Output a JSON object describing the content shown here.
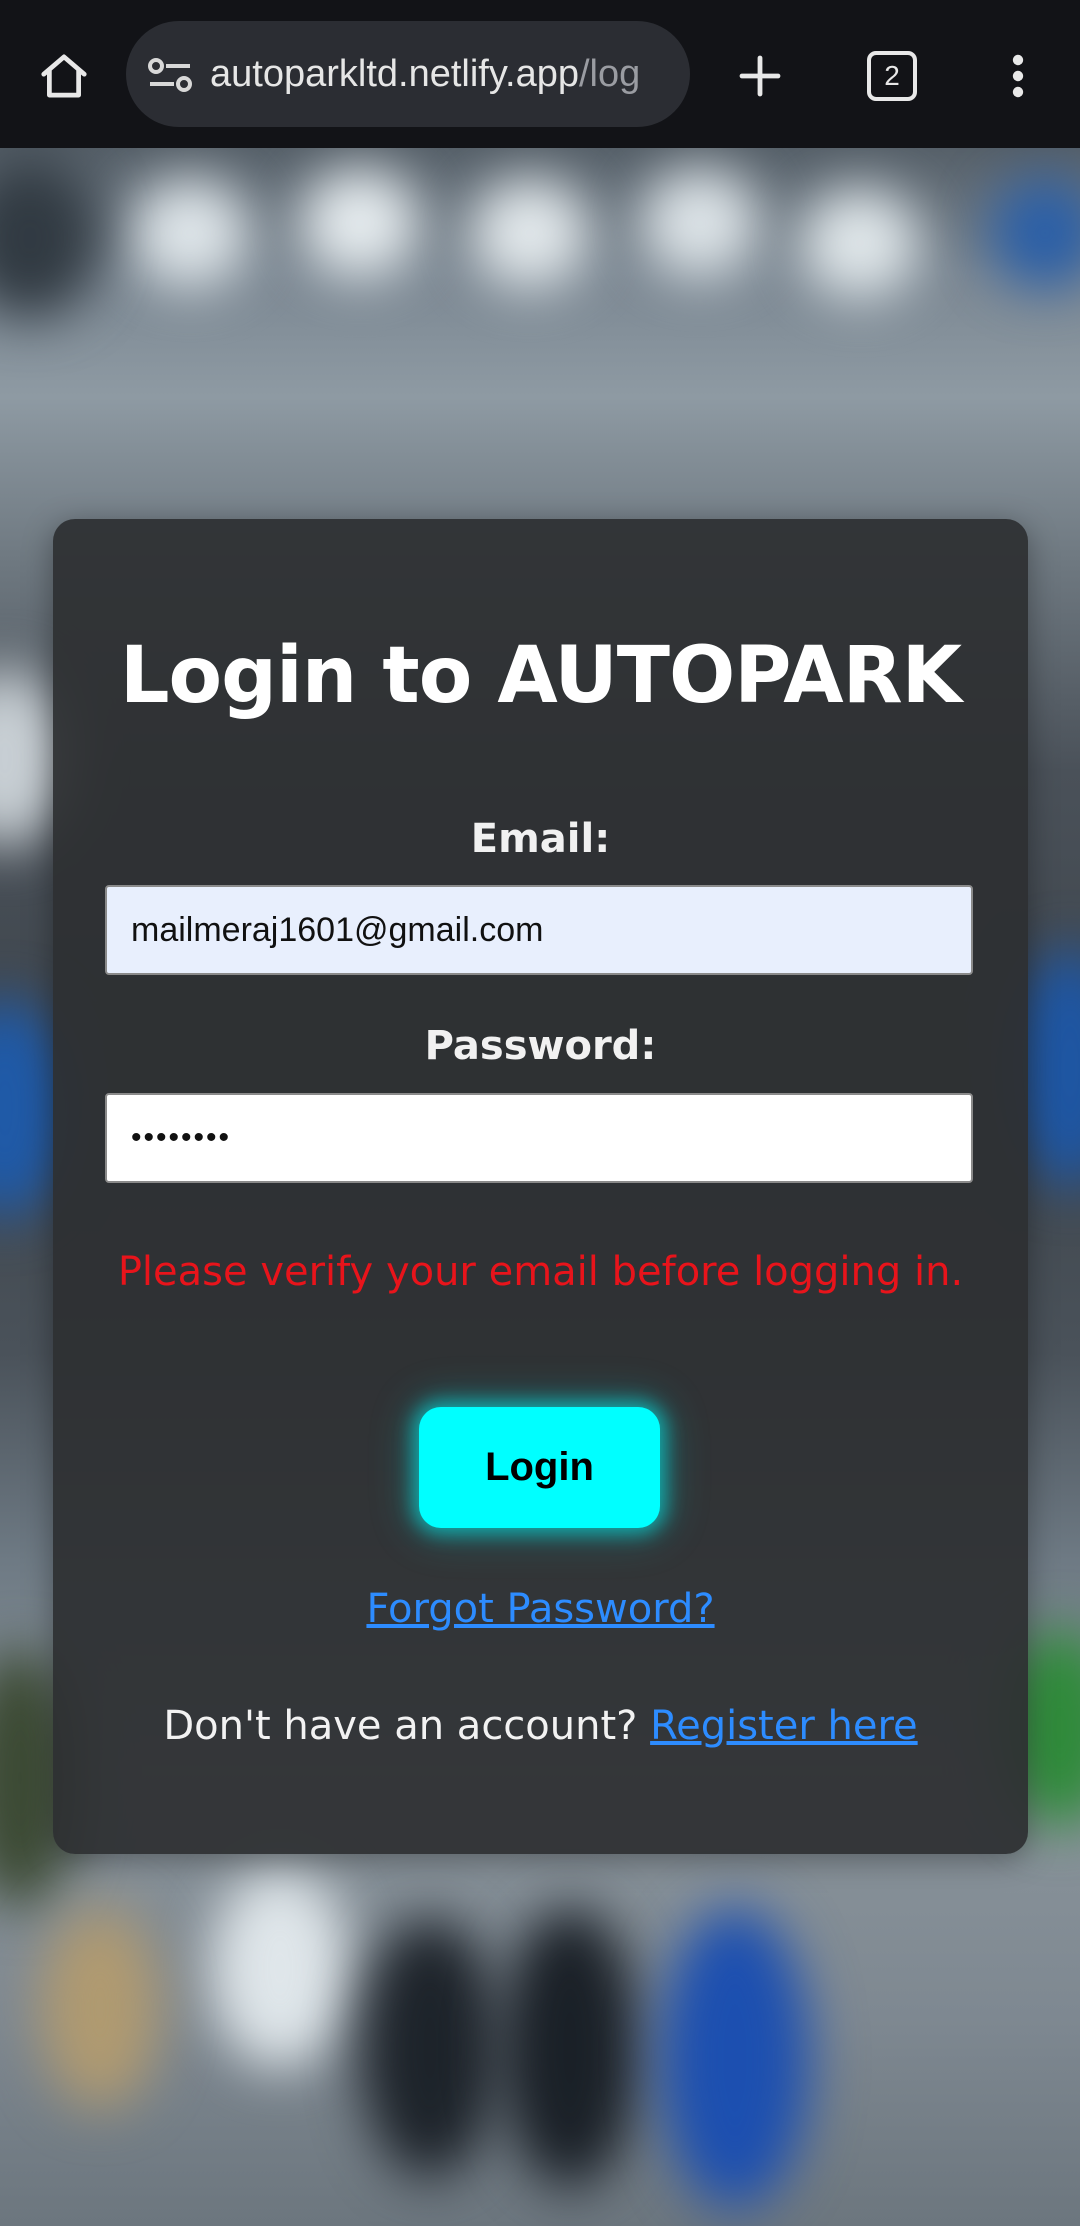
{
  "browser": {
    "url_host": "autoparkltd.netlify.app",
    "url_path": "/log",
    "tab_count": "2"
  },
  "login": {
    "title": "Login to AUTOPARK",
    "email_label": "Email:",
    "email_value": "mailmeraj1601@gmail.com",
    "password_label": "Password:",
    "password_value": "••••••••",
    "error_message": "Please verify your email before logging in.",
    "login_button": "Login",
    "forgot_password": "Forgot Password?",
    "register_prompt": "Don't have an account?",
    "register_link": "Register here"
  },
  "colors": {
    "accent_button": "#00ffff",
    "error": "#e8141b",
    "link": "#2d8cff",
    "card": "#2d2f32"
  },
  "icons": [
    "home-icon",
    "site-settings-icon",
    "plus-icon",
    "tab-switcher-icon",
    "more-vert-icon"
  ]
}
